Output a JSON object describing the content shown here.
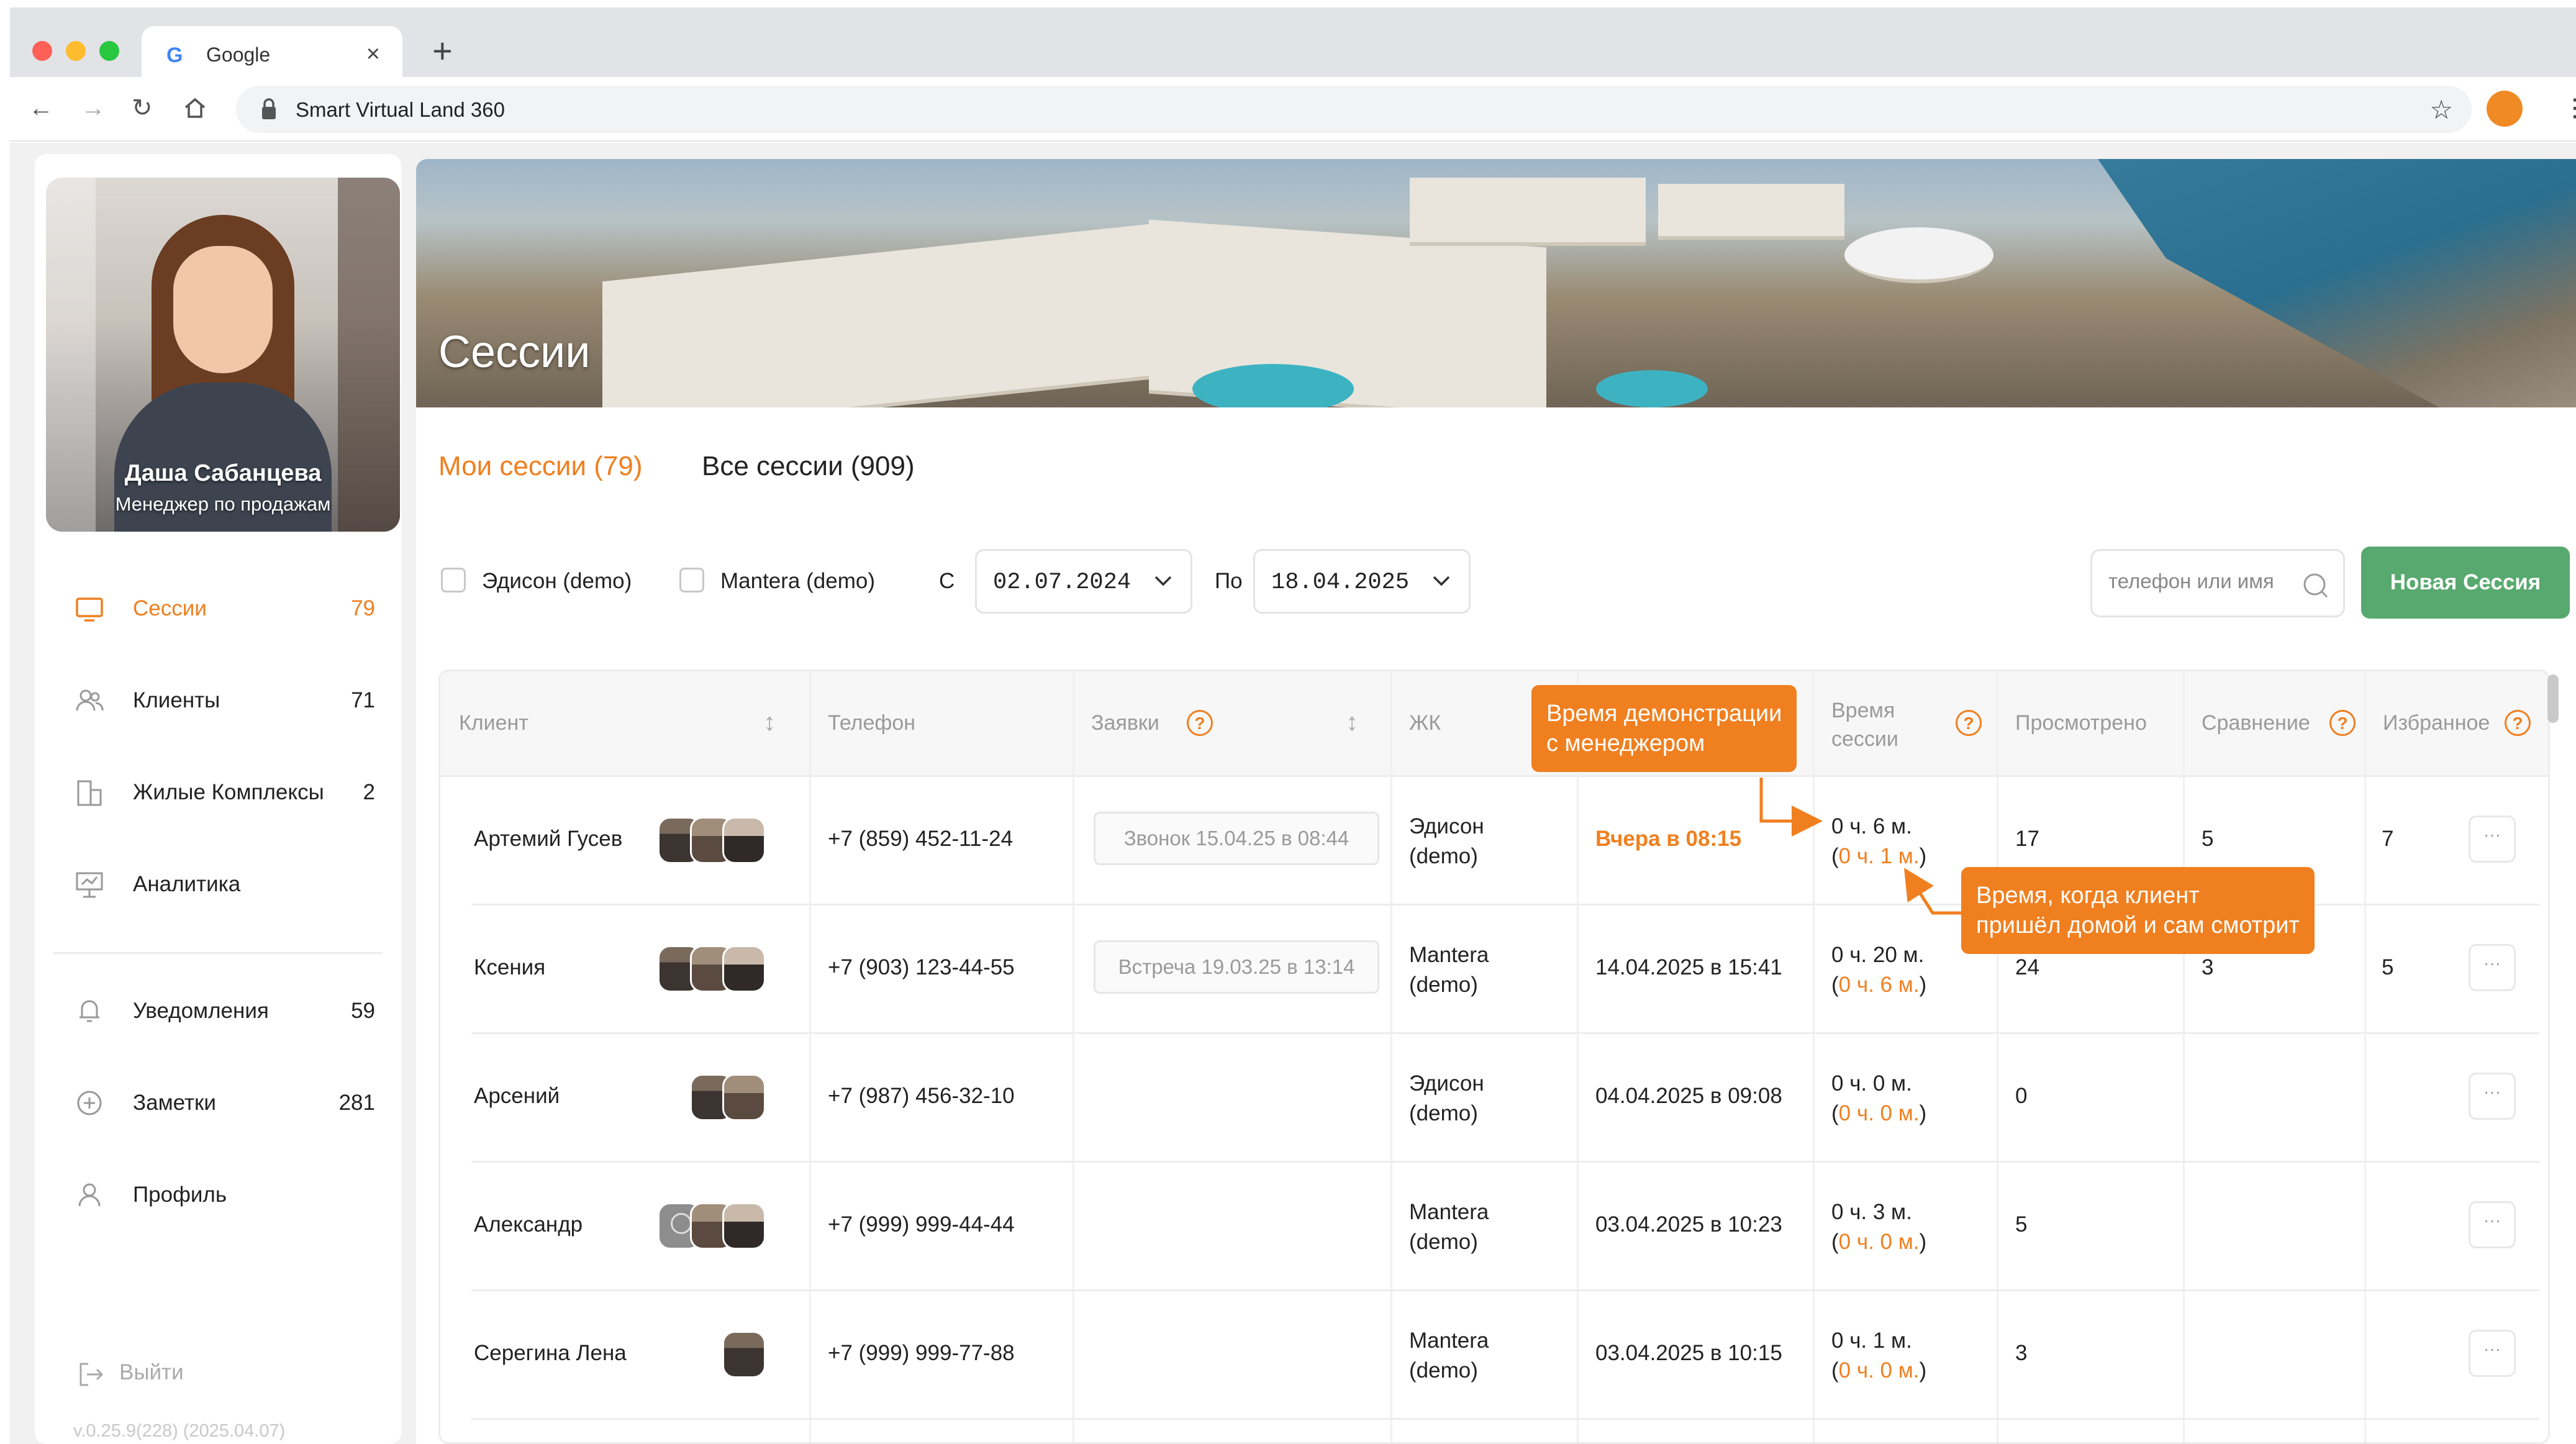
{
  "browser": {
    "tab_title": "Google",
    "url": "Smart Virtual Land 360"
  },
  "profile": {
    "name": "Даша Сабанцева",
    "role": "Менеджер по продажам"
  },
  "sidebar": {
    "items": [
      {
        "label": "Сессии",
        "count": "79",
        "icon": "monitor-icon",
        "active": true
      },
      {
        "label": "Клиенты",
        "count": "71",
        "icon": "users-icon"
      },
      {
        "label": "Жилые Комплексы",
        "count": "2",
        "icon": "buildings-icon"
      },
      {
        "label": "Аналитика",
        "count": "",
        "icon": "presentation-icon"
      },
      {
        "label": "Уведомления",
        "count": "59",
        "icon": "bell-icon"
      },
      {
        "label": "Заметки",
        "count": "281",
        "icon": "plus-circle-icon"
      },
      {
        "label": "Профиль",
        "count": "",
        "icon": "user-icon"
      }
    ],
    "logout": "Выйти",
    "version": "v.0.25.9(228) (2025.04.07)"
  },
  "hero": {
    "title": "Сессии"
  },
  "tabs": {
    "mine": "Мои сессии (79)",
    "all": "Все сессии (909)"
  },
  "filters": {
    "complex1": "Эдисон (demo)",
    "complex2": "Mantera (demo)",
    "from_label": "С",
    "from_date": "02.07.2024",
    "to_label": "По",
    "to_date": "18.04.2025",
    "search_placeholder": "телефон или имя",
    "new_session": "Новая Сессия"
  },
  "table": {
    "headers": {
      "client": "Клиент",
      "phone": "Телефон",
      "orders": "Заявки",
      "complex": "ЖК",
      "last_date": "",
      "duration": "Время\nсессии",
      "viewed": "Просмотрено",
      "compare": "Сравнение",
      "favorites": "Избранное"
    },
    "rows": [
      {
        "name": "Артемий Гусев",
        "phone": "+7 (859) 452-11-24",
        "order": "Звонок 15.04.25 в 08:44",
        "complex": "Эдисон\n(demo)",
        "date": "Вчера в 08:15",
        "date_highlight": true,
        "dur": "0 ч. 6 м.",
        "dur_self": "0 ч. 1 м.",
        "viewed": "17",
        "compare": "5",
        "fav": "7",
        "avatars": [
          "p1",
          "p2",
          "p3"
        ]
      },
      {
        "name": "Ксения",
        "phone": "+7 (903) 123-44-55",
        "order": "Встреча 19.03.25 в 13:14",
        "complex": "Mantera\n(demo)",
        "date": "14.04.2025 в 15:41",
        "date_highlight": false,
        "dur": "0 ч. 20 м.",
        "dur_self": "0 ч. 6 м.",
        "viewed": "24",
        "compare": "3",
        "fav": "5",
        "avatars": [
          "p1",
          "p2",
          "p3"
        ]
      },
      {
        "name": "Арсений",
        "phone": "+7 (987) 456-32-10",
        "order": "",
        "complex": "Эдисон\n(demo)",
        "date": "04.04.2025 в 09:08",
        "date_highlight": false,
        "dur": "0 ч. 0 м.",
        "dur_self": "0 ч. 0 м.",
        "viewed": "0",
        "compare": "",
        "fav": "",
        "avatars": [
          "p1",
          "p2"
        ]
      },
      {
        "name": "Александр",
        "phone": "+7 (999) 999-44-44",
        "order": "",
        "complex": "Mantera\n(demo)",
        "date": "03.04.2025 в 10:23",
        "date_highlight": false,
        "dur": "0 ч. 3 м.",
        "dur_self": "0 ч. 0 м.",
        "viewed": "5",
        "compare": "",
        "fav": "",
        "avatars": [
          "gray",
          "p2",
          "p3"
        ]
      },
      {
        "name": "Серегина Лена",
        "phone": "+7 (999) 999-77-88",
        "order": "",
        "complex": "Mantera\n(demo)",
        "date": "03.04.2025 в 10:15",
        "date_highlight": false,
        "dur": "0 ч. 1 м.",
        "dur_self": "0 ч. 0 м.",
        "viewed": "3",
        "compare": "",
        "fav": "",
        "avatars": [
          "p1"
        ]
      }
    ],
    "more_label": "···"
  },
  "callouts": {
    "manager_time": "Время демонстрации\nс менеджером",
    "client_time": "Время, когда клиент\nпришёл домой и сам смотрит"
  },
  "colors": {
    "accent": "#f07f1f",
    "button_green": "#58a96f",
    "app_bg": "#f1f1f1"
  }
}
